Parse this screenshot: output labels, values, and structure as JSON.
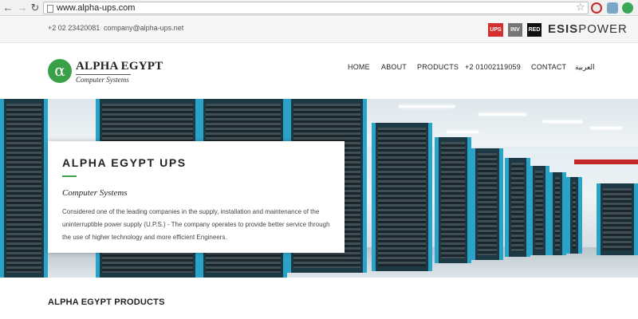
{
  "browser": {
    "url": "www.alpha-ups.com",
    "nav_back": "←",
    "nav_forward": "→",
    "nav_reload": "↻",
    "star": "☆"
  },
  "topbar": {
    "phone": "+2 02 23420081",
    "email": "company@alpha-ups.net",
    "brands": [
      {
        "label": "UPS",
        "color": "#d32f2f"
      },
      {
        "label": "INV",
        "color": "#757575"
      },
      {
        "label": "RED",
        "color": "#111111"
      }
    ],
    "esis_bold": "ESIS",
    "esis_rest": "POWER"
  },
  "header": {
    "logo_symbol": "α",
    "logo_title": "ALPHA EGYPT",
    "logo_subtitle": "Computer Systems",
    "nav": {
      "home": "HOME",
      "about": "ABOUT",
      "products": "PRODUCTS",
      "phone": "+2 01002119059",
      "contact": "CONTACT",
      "arabic": "العربية"
    }
  },
  "hero": {
    "title": "ALPHA EGYPT UPS",
    "subtitle": "Computer Systems",
    "description": "Considered one of the leading companies in the supply, installation and maintenance of the uninterruptible power supply (U.P.S.) - The company operates to provide better service through the use of higher technology and more efficient Engineers."
  },
  "section": {
    "products_title": "ALPHA EGYPT PRODUCTS"
  },
  "colors": {
    "accent_green": "#3aa047",
    "rack_blue": "#2aa3c9"
  }
}
